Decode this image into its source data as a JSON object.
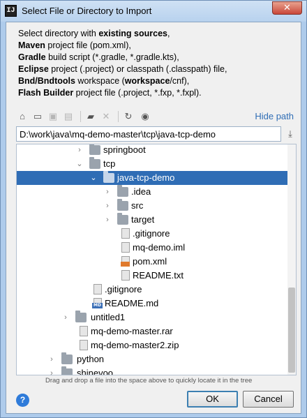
{
  "window": {
    "title": "Select File or Directory to Import",
    "app_icon": "IJ",
    "close_glyph": "✕"
  },
  "description": {
    "line1_pre": "Select directory with ",
    "line1_bold": "existing sources",
    "line1_post": ",",
    "line2_bold": "Maven",
    "line2_post": " project file (pom.xml),",
    "line3_bold": "Gradle",
    "line3_post": " build script (*.gradle, *.gradle.kts),",
    "line4_bold": "Eclipse",
    "line4_post": " project (.project) or classpath (.classpath) file,",
    "line5_bold": "Bnd/Bndtools",
    "line5_mid": " workspace (",
    "line5_bold2": "workspace",
    "line5_post": "/cnf),",
    "line6_bold": "Flash Builder",
    "line6_post": " project file (.project, *.fxp, *.fxpl)."
  },
  "toolbar": {
    "icons": [
      "home-icon",
      "desktop-icon",
      "project-icon",
      "module-icon",
      "new-folder-icon",
      "delete-icon",
      "refresh-icon",
      "show-hidden-icon"
    ],
    "hide_path_label": "Hide path"
  },
  "path": {
    "value": "D:\\work\\java\\mq-demo-master\\tcp\\java-tcp-demo"
  },
  "tree": {
    "rows": [
      {
        "label": "springboot",
        "arrow": "›",
        "type": "folder"
      },
      {
        "label": "tcp",
        "arrow": "⌄",
        "type": "folder"
      },
      {
        "label": "java-tcp-demo",
        "arrow": "⌄",
        "type": "folder"
      },
      {
        "label": ".idea",
        "arrow": "›",
        "type": "folder"
      },
      {
        "label": "src",
        "arrow": "›",
        "type": "folder"
      },
      {
        "label": "target",
        "arrow": "›",
        "type": "folder"
      },
      {
        "label": ".gitignore",
        "arrow": "",
        "type": "file"
      },
      {
        "label": "mq-demo.iml",
        "arrow": "",
        "type": "file"
      },
      {
        "label": "pom.xml",
        "arrow": "",
        "type": "xml"
      },
      {
        "label": "README.txt",
        "arrow": "",
        "type": "file"
      },
      {
        "label": ".gitignore",
        "arrow": "",
        "type": "file"
      },
      {
        "label": "README.md",
        "arrow": "",
        "type": "md"
      },
      {
        "label": "untitled1",
        "arrow": "›",
        "type": "folder"
      },
      {
        "label": "mq-demo-master.rar",
        "arrow": "",
        "type": "archive"
      },
      {
        "label": "mq-demo-master2.zip",
        "arrow": "",
        "type": "archive"
      },
      {
        "label": "python",
        "arrow": "›",
        "type": "folder"
      },
      {
        "label": "shinevoo",
        "arrow": "›",
        "type": "folder"
      }
    ],
    "selected": "java-tcp-demo",
    "md_badge": "MD"
  },
  "hint": "Drag and drop a file into the space above to quickly locate it in the tree",
  "buttons": {
    "help": "?",
    "ok": "OK",
    "cancel": "Cancel"
  },
  "colors": {
    "selection": "#2f6db5",
    "link": "#2f6db5",
    "help": "#2f7bd9"
  }
}
